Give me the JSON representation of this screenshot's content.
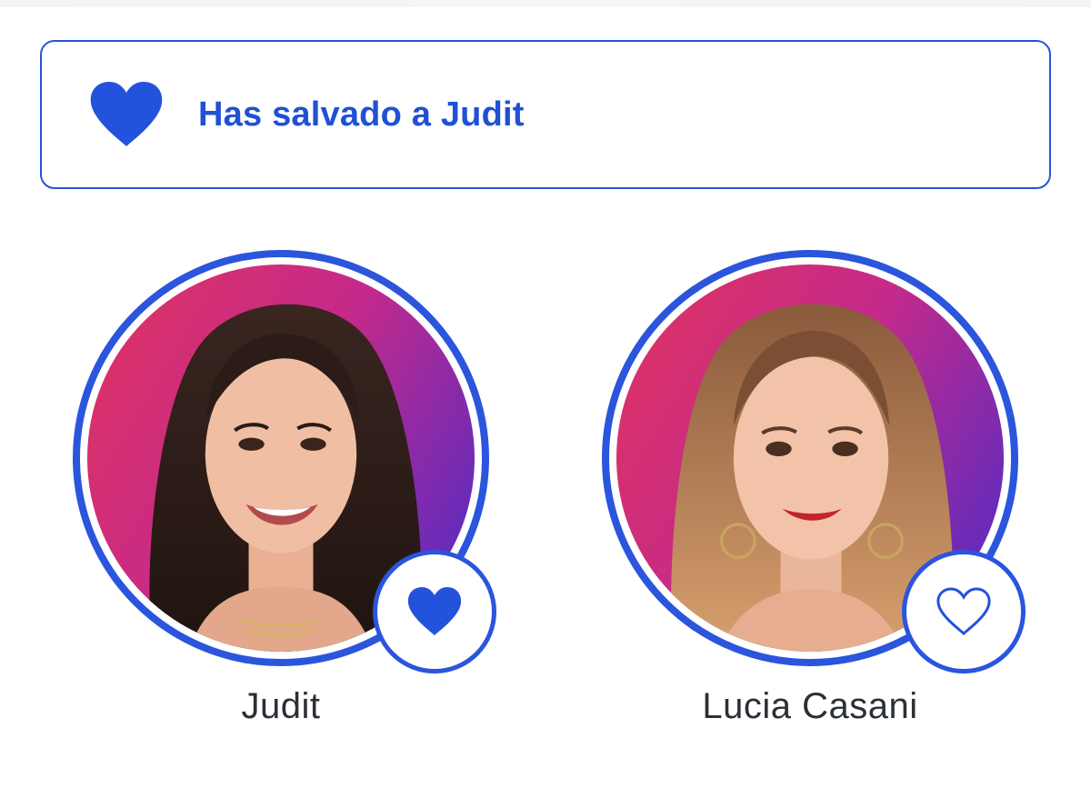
{
  "banner": {
    "message": "Has salvado a Judit",
    "icon": "heart-filled-icon",
    "accent_color": "#2050d6"
  },
  "contestants": [
    {
      "name": "Judit",
      "saved": true,
      "vote_icon": "heart-filled-icon"
    },
    {
      "name": "Lucia Casani",
      "saved": false,
      "vote_icon": "heart-outline-icon"
    }
  ],
  "colors": {
    "ring": "#2a55dc",
    "photo_background_start": "#e0335f",
    "photo_background_end": "#6a2bb8"
  }
}
